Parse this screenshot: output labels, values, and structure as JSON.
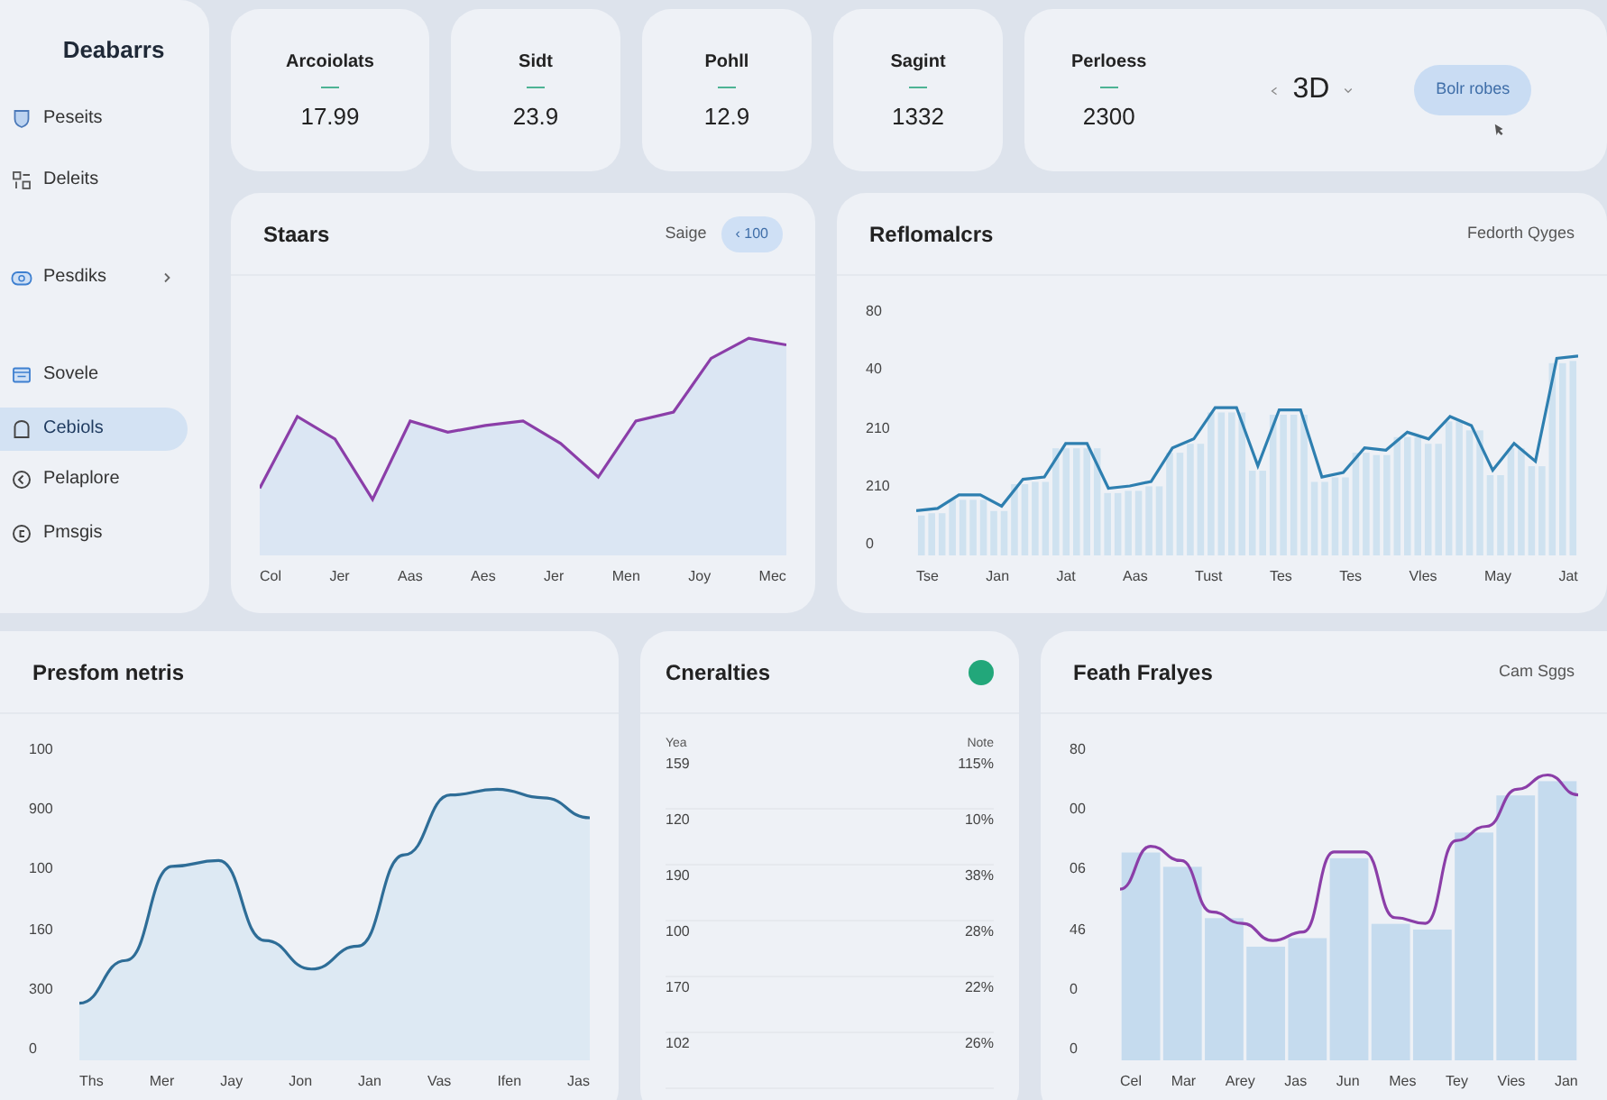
{
  "sidebar": {
    "title": "Deabarrs",
    "items": [
      {
        "label": "Peseits",
        "selected": false,
        "expandable": false
      },
      {
        "label": "Deleits",
        "selected": false,
        "expandable": false
      },
      {
        "label": "Pesdiks",
        "selected": false,
        "expandable": true
      },
      {
        "label": "Sovele",
        "selected": false,
        "expandable": false
      },
      {
        "label": "Cebiols",
        "selected": true,
        "expandable": false
      },
      {
        "label": "Pelaplore",
        "selected": false,
        "expandable": false
      },
      {
        "label": "Pmsgis",
        "selected": false,
        "expandable": false
      }
    ]
  },
  "stats": [
    {
      "label": "Arcoiolats",
      "value": "17.99"
    },
    {
      "label": "Sidt",
      "value": "23.9"
    },
    {
      "label": "Pohll",
      "value": "12.9"
    },
    {
      "label": "Sagint",
      "value": "1332"
    },
    {
      "label": "Perloess",
      "value": "2300"
    }
  ],
  "period": {
    "value": "3D",
    "button": "Bolr robes"
  },
  "charts": [
    {
      "title": "Staars",
      "note": "Saige",
      "pill": "‹ 100",
      "xlabels": [
        "Col",
        "Jer",
        "Aas",
        "Aes",
        "Jer",
        "Men",
        "Joy",
        "Mec"
      ]
    },
    {
      "title": "Reflomalcrs",
      "note": "Fedorth Qyges",
      "yticks": [
        "80",
        "40",
        "210",
        "210",
        "0"
      ],
      "xlabels": [
        "Tse",
        "Jan",
        "Jat",
        "Aas",
        "Tust",
        "Tes",
        "Tes",
        "Vles",
        "May",
        "Jat"
      ]
    },
    {
      "title": "Presfom netris",
      "yticks": [
        "100",
        "900",
        "100",
        "160",
        "300",
        "0"
      ],
      "xlabels": [
        "Ths",
        "Mer",
        "Jay",
        "Jon",
        "Jan",
        "Vas",
        "Ifen",
        "Jas"
      ]
    },
    {
      "title": "Feath Fralyes",
      "note": "Cam Sggs",
      "yticks": [
        "80",
        "00",
        "06",
        "46",
        "0",
        "0"
      ],
      "xlabels": [
        "Cel",
        "Mar",
        "Arey",
        "Jas",
        "Jun",
        "Mes",
        "Tey",
        "Vies",
        "Jan"
      ]
    }
  ],
  "table": {
    "title": "Cneralties",
    "columns": [
      "Yea",
      "Note"
    ],
    "rows": [
      [
        "159",
        "115%"
      ],
      [
        "120",
        "10%"
      ],
      [
        "190",
        "38%"
      ],
      [
        "100",
        "28%"
      ],
      [
        "170",
        "22%"
      ],
      [
        "102",
        "26%"
      ]
    ]
  }
}
